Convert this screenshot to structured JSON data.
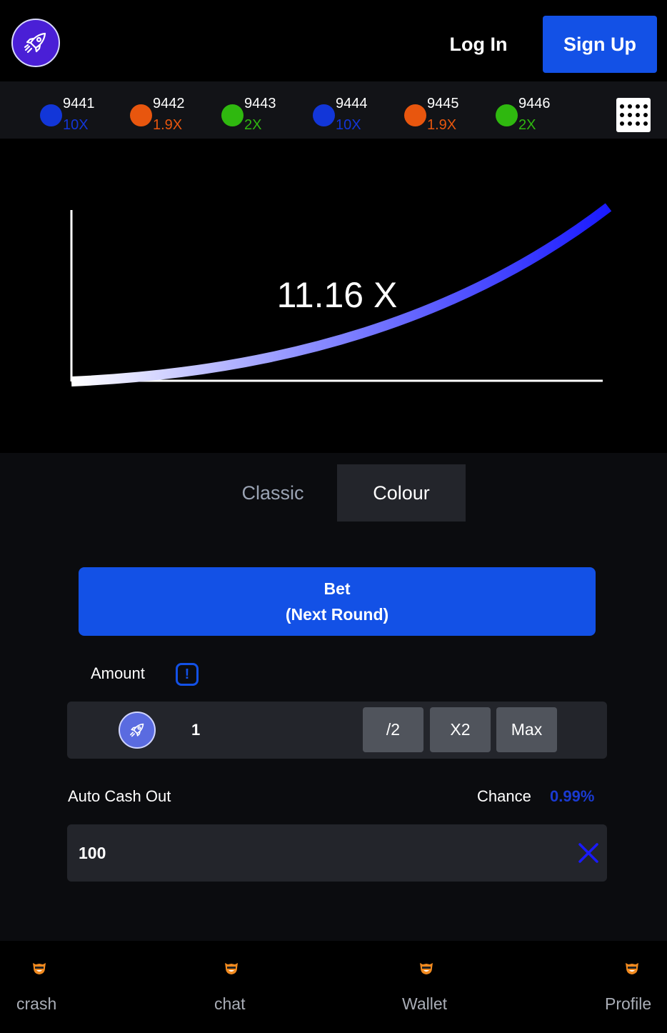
{
  "header": {
    "login_label": "Log In",
    "signup_label": "Sign Up"
  },
  "history": [
    {
      "round": "9441",
      "multiplier": "10X",
      "color": "#1236d8"
    },
    {
      "round": "9442",
      "multiplier": "1.9X",
      "color": "#e8560e"
    },
    {
      "round": "9443",
      "multiplier": "2X",
      "color": "#2fb80f"
    },
    {
      "round": "9444",
      "multiplier": "10X",
      "color": "#1236d8"
    },
    {
      "round": "9445",
      "multiplier": "1.9X",
      "color": "#e8560e"
    },
    {
      "round": "9446",
      "multiplier": "2X",
      "color": "#2fb80f"
    }
  ],
  "game": {
    "multiplier": "11.16 X"
  },
  "tabs": {
    "classic": "Classic",
    "colour": "Colour"
  },
  "bet": {
    "line1": "Bet",
    "line2": "(Next Round)"
  },
  "amount": {
    "label": "Amount",
    "value": "1",
    "half": "/2",
    "double": "X2",
    "max": "Max"
  },
  "cashout": {
    "label": "Auto Cash Out",
    "value": "100",
    "chance_label": "Chance",
    "chance_value": "0.99%"
  },
  "nav": [
    {
      "label": "crash"
    },
    {
      "label": "chat"
    },
    {
      "label": "Wallet"
    },
    {
      "label": "Profile"
    }
  ],
  "colors": {
    "accent": "#1351e6",
    "curve_end": "#1a1aff",
    "panel": "#23252b"
  }
}
